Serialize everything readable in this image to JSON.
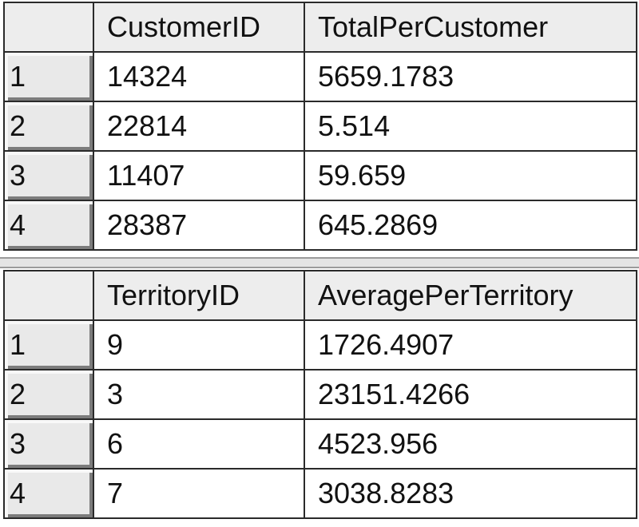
{
  "result1": {
    "columns": [
      "CustomerID",
      "TotalPerCustomer"
    ],
    "rows": [
      {
        "n": "1",
        "c1": "14324",
        "c2": "5659.1783"
      },
      {
        "n": "2",
        "c1": "22814",
        "c2": "5.514"
      },
      {
        "n": "3",
        "c1": "11407",
        "c2": "59.659"
      },
      {
        "n": "4",
        "c1": "28387",
        "c2": "645.2869"
      }
    ]
  },
  "result2": {
    "columns": [
      "TerritoryID",
      "AveragePerTerritory"
    ],
    "rows": [
      {
        "n": "1",
        "c1": "9",
        "c2": "1726.4907"
      },
      {
        "n": "2",
        "c1": "3",
        "c2": "23151.4266"
      },
      {
        "n": "3",
        "c1": "6",
        "c2": "4523.956"
      },
      {
        "n": "4",
        "c1": "7",
        "c2": "3038.8283"
      }
    ]
  }
}
